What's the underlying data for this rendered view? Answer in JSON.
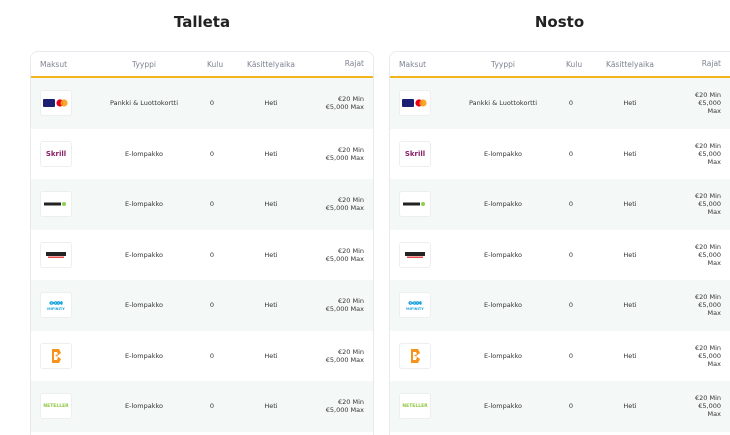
{
  "deposit": {
    "title": "Talleta",
    "headers": {
      "pay": "Maksut",
      "type": "Tyyppi",
      "fee": "Kulu",
      "time": "Käsittelyaika",
      "limits": "Rajat"
    },
    "rows": [
      {
        "icon": "visa-mastercard-icon",
        "type": "Pankki & Luottokortti",
        "fee": "0",
        "time": "Heti",
        "min": "€20 Min",
        "max": "€5,000 Max"
      },
      {
        "icon": "skrill-icon",
        "logo_text": "Skrill",
        "type": "E-lompakko",
        "fee": "0",
        "time": "Heti",
        "min": "€20 Min",
        "max": "€5,000 Max"
      },
      {
        "icon": "astropay-icon",
        "type": "E-lompakko",
        "fee": "0",
        "time": "Heti",
        "min": "€20 Min",
        "max": "€5,000 Max"
      },
      {
        "icon": "jeton-icon",
        "type": "E-lompakko",
        "fee": "0",
        "time": "Heti",
        "min": "€20 Min",
        "max": "€5,000 Max"
      },
      {
        "icon": "mifinity-icon",
        "logo_text": "MIFINITY",
        "type": "E-lompakko",
        "fee": "0",
        "time": "Heti",
        "min": "€20 Min",
        "max": "€5,000 Max"
      },
      {
        "icon": "bitcoin-wallet-icon",
        "type": "E-lompakko",
        "fee": "0",
        "time": "Heti",
        "min": "€20 Min",
        "max": "€5,000 Max"
      },
      {
        "icon": "neteller-icon",
        "logo_text": "NETELLER",
        "type": "E-lompakko",
        "fee": "0",
        "time": "Heti",
        "min": "€20 Min",
        "max": "€5,000 Max"
      }
    ]
  },
  "withdraw": {
    "title": "Nosto",
    "headers": {
      "pay": "Maksut",
      "type": "Tyyppi",
      "fee": "Kulu",
      "time": "Käsittelyaika",
      "limits": "Rajat"
    },
    "rows": [
      {
        "icon": "visa-mastercard-icon",
        "type": "Pankki & Luottokortti",
        "fee": "0",
        "time": "Heti",
        "min": "€20 Min",
        "max": "€5,000 Max"
      },
      {
        "icon": "skrill-icon",
        "logo_text": "Skrill",
        "type": "E-lompakko",
        "fee": "0",
        "time": "Heti",
        "min": "€20 Min",
        "max": "€5,000 Max"
      },
      {
        "icon": "astropay-icon",
        "type": "E-lompakko",
        "fee": "0",
        "time": "Heti",
        "min": "€20 Min",
        "max": "€5,000 Max"
      },
      {
        "icon": "jeton-icon",
        "type": "E-lompakko",
        "fee": "0",
        "time": "Heti",
        "min": "€20 Min",
        "max": "€5,000 Max"
      },
      {
        "icon": "mifinity-icon",
        "logo_text": "MIFINITY",
        "type": "E-lompakko",
        "fee": "0",
        "time": "Heti",
        "min": "€20 Min",
        "max": "€5,000 Max"
      },
      {
        "icon": "bitcoin-wallet-icon",
        "type": "E-lompakko",
        "fee": "0",
        "time": "Heti",
        "min": "€20 Min",
        "max": "€5,000 Max"
      },
      {
        "icon": "neteller-icon",
        "logo_text": "NETELLER",
        "type": "E-lompakko",
        "fee": "0",
        "time": "Heti",
        "min": "€20 Min",
        "max": "€5,000 Max"
      }
    ]
  },
  "colors": {
    "accent": "#f2b51c",
    "row_alt": "#f4f9f7",
    "skrill": "#862165",
    "mifinity": "#1fa4de",
    "neteller": "#8dc63f"
  }
}
